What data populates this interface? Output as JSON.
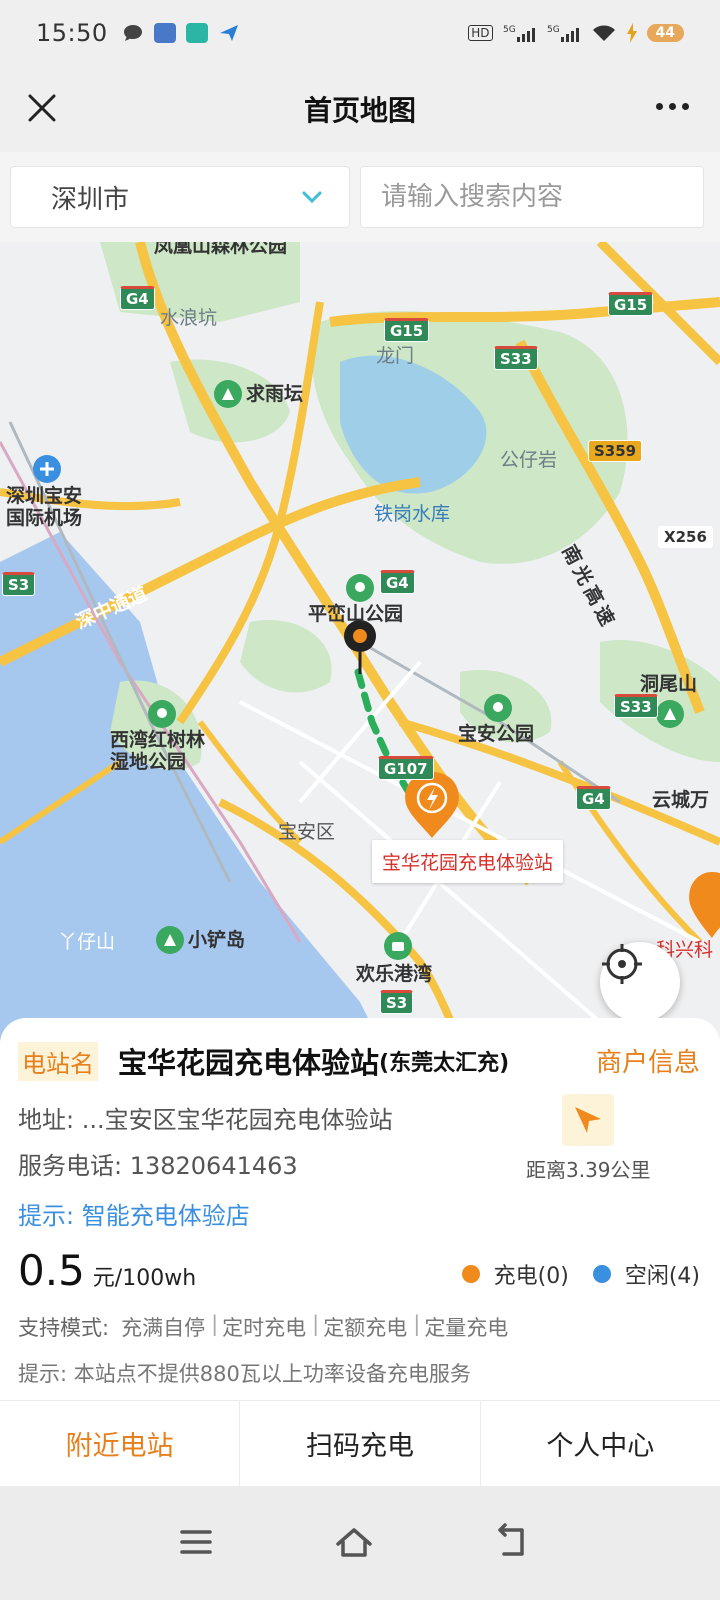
{
  "status_bar": {
    "time": "15:50",
    "battery": "44"
  },
  "header": {
    "title": "首页地图"
  },
  "search": {
    "city": "深圳市",
    "placeholder": "请输入搜索内容"
  },
  "map": {
    "labels": {
      "fenghuang": "凤凰山森林公园",
      "shuilangkeng": "水浪坑",
      "qiuyutan": "求雨坛",
      "longmen": "龙门",
      "gongziyan": "公仔岩",
      "tiegang": "铁岗水库",
      "airport": "深圳宝安\n国际机场",
      "shenzhong": "深中通道",
      "pingluanshan": "平峦山公园",
      "nanguang": "南光高速",
      "dongweishan": "洞尾山",
      "xiwan": "西湾红树林\n湿地公园",
      "baoanpark": "宝安公园",
      "baoanqu": "宝安区",
      "yunchengwan": "云城万",
      "yazaishan": "丫仔山",
      "xiaochandao": "小铲岛",
      "huanlegang": "欢乐港湾",
      "kexing": "科兴科"
    },
    "shields": {
      "g4a": "G4",
      "g15a": "G15",
      "g15b": "G15",
      "s33a": "S33",
      "s359": "S359",
      "x256": "X256",
      "s3a": "S3",
      "g4b": "G4",
      "s33b": "S33",
      "g107": "G107",
      "g4c": "G4",
      "s3b": "S3"
    },
    "callout": "宝华花园充电体验站"
  },
  "station": {
    "tag": "电站名",
    "name": "宝华花园充电体验站",
    "subname": "(东莞太汇充)",
    "merchant": "商户信息",
    "address": "地址: ...宝安区宝华花园充电体验站",
    "phone": "服务电话: 13820641463",
    "distance": "距离3.39公里",
    "tip": "提示: 智能充电体验店",
    "price": "0.5",
    "price_unit": "元/100wh",
    "charging_label": "充电(0)",
    "idle_label": "空闲(4)",
    "modes_label": "支持模式:",
    "modes": [
      "充满自停",
      "定时充电",
      "定额充电",
      "定量充电"
    ],
    "notice": "提示:  本站点不提供880瓦以上功率设备充电服务"
  },
  "tabs": [
    "附近电站",
    "扫码充电",
    "个人中心"
  ],
  "colors": {
    "accent": "#e7801c",
    "charging": "#f08a1c",
    "idle": "#3a8fe0"
  }
}
